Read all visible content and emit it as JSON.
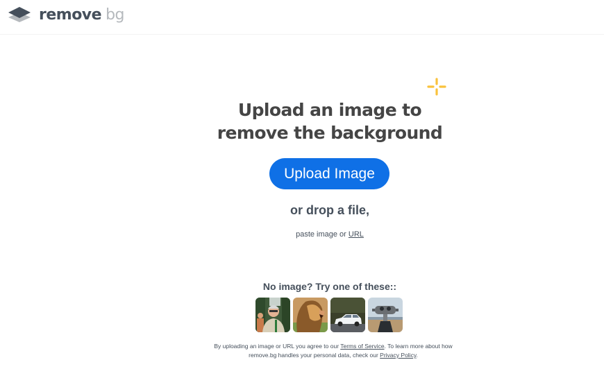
{
  "header": {
    "logo": {
      "icon": "layers-logo-icon",
      "word1": "remove",
      "word2": "bg"
    }
  },
  "hero": {
    "sparkle_icon": "sparkle-icon",
    "headline_line1": "Upload an image to",
    "headline_line2": "remove the background",
    "upload_button": "Upload Image",
    "drop_text": "or drop a file,",
    "paste_prefix": "paste image or ",
    "paste_link": "URL"
  },
  "samples": {
    "title": "No image? Try one of these::",
    "items": [
      {
        "label": "Smiling man with glasses",
        "icon": "person-thumbnail"
      },
      {
        "label": "Lion",
        "icon": "lion-thumbnail"
      },
      {
        "label": "White car",
        "icon": "car-thumbnail"
      },
      {
        "label": "Coin-operated binoculars",
        "icon": "binoculars-thumbnail"
      }
    ]
  },
  "legal": {
    "part1": "By uploading an image or URL you agree to our ",
    "terms_link": "Terms of Service",
    "part2": ". To learn more about how remove.bg handles your personal data, check our ",
    "privacy_link": "Privacy Policy",
    "part3": "."
  },
  "colors": {
    "accent": "#0f70e6",
    "sparkle": "#f9c23c",
    "text": "#454545",
    "logo_dark": "#454f5b",
    "logo_light": "#b5b9bd"
  }
}
